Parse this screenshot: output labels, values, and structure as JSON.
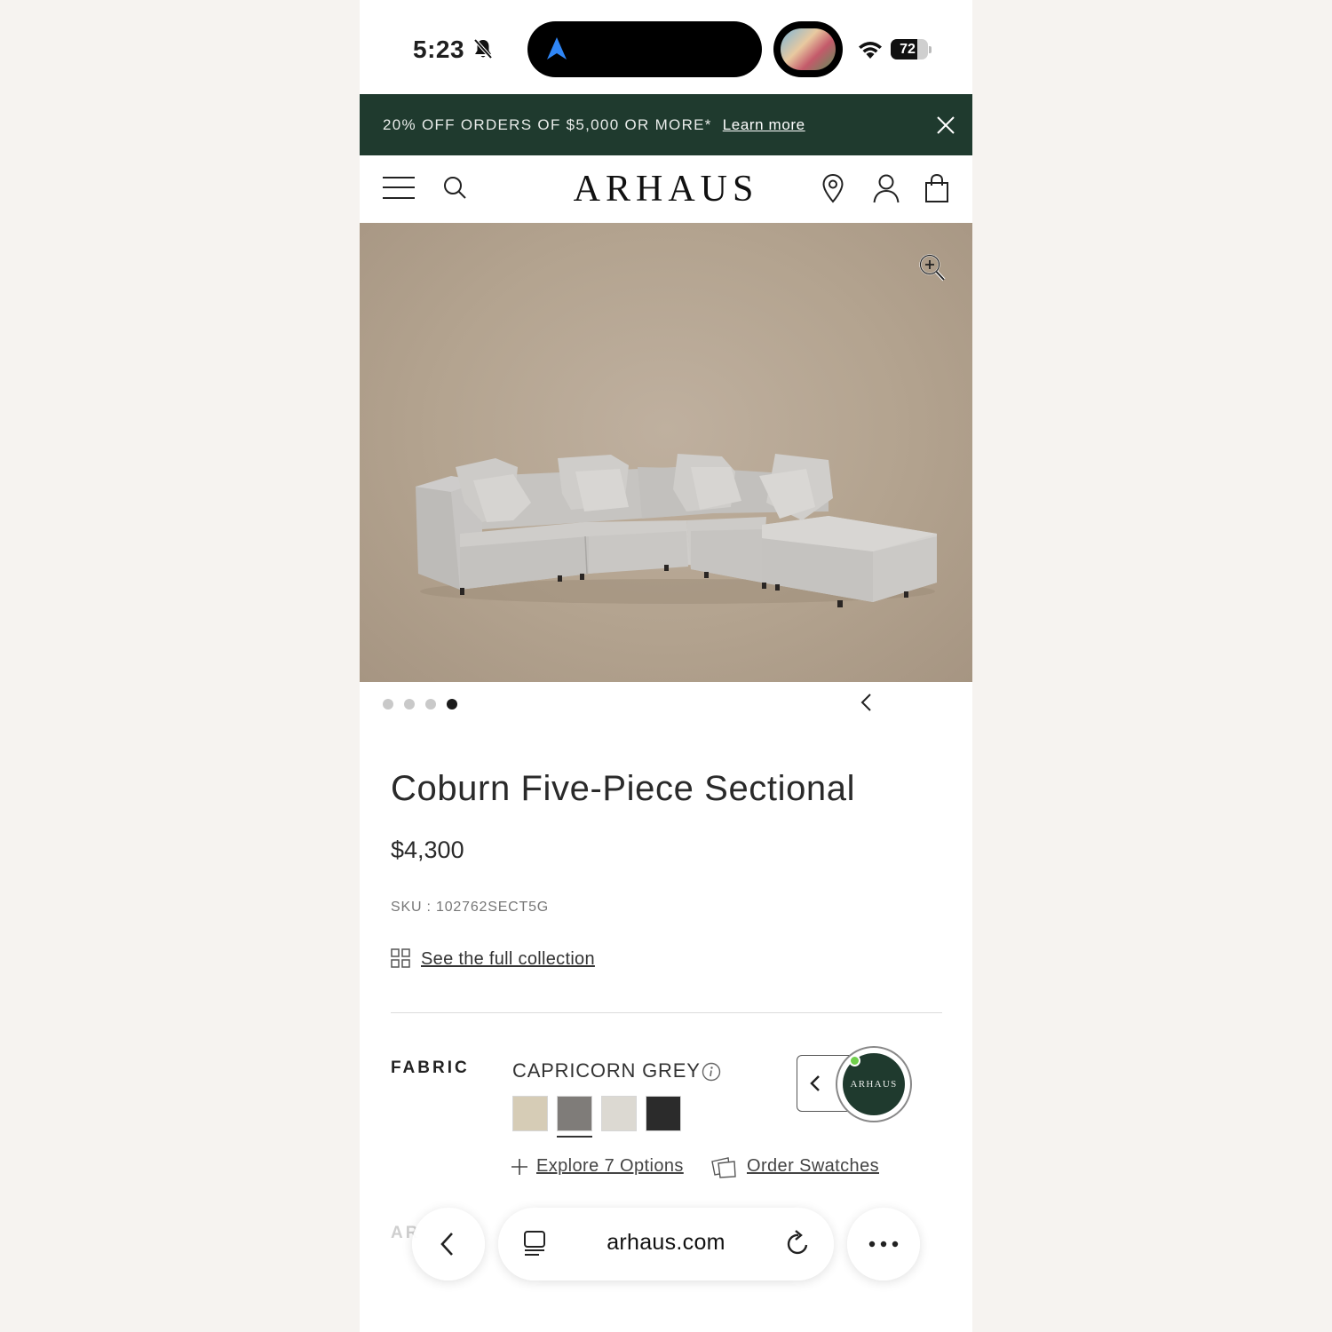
{
  "status_bar": {
    "time": "5:23",
    "battery_percent": "72",
    "battery_level": 0.72
  },
  "promo": {
    "text": "20% OFF ORDERS OF $5,000 OR MORE*",
    "link": "Learn more"
  },
  "header": {
    "logo": "ARHAUS"
  },
  "carousel": {
    "total": 4,
    "active_index": 3
  },
  "product": {
    "title": "Coburn Five-Piece Sectional",
    "price": "$4,300",
    "sku": "SKU : 102762SECT5G",
    "collection_link": "See the full collection"
  },
  "fabric": {
    "label": "FABRIC",
    "selected_name": "CAPRICORN GREY",
    "swatches": [
      {
        "color": "#d6ccb6",
        "selected": false
      },
      {
        "color": "#7f7c79",
        "selected": true
      },
      {
        "color": "#dcd9d2",
        "selected": false
      },
      {
        "color": "#2b2b2b",
        "selected": false
      }
    ],
    "explore_link": "Explore 7 Options",
    "order_link": "Order Swatches"
  },
  "next_section_partial": "AR",
  "chat": {
    "avatar_text": "ARHAUS"
  },
  "browser": {
    "url": "arhaus.com"
  },
  "colors": {
    "brand_green": "#1f3a2e",
    "hero_bg": "#b3a38f"
  }
}
